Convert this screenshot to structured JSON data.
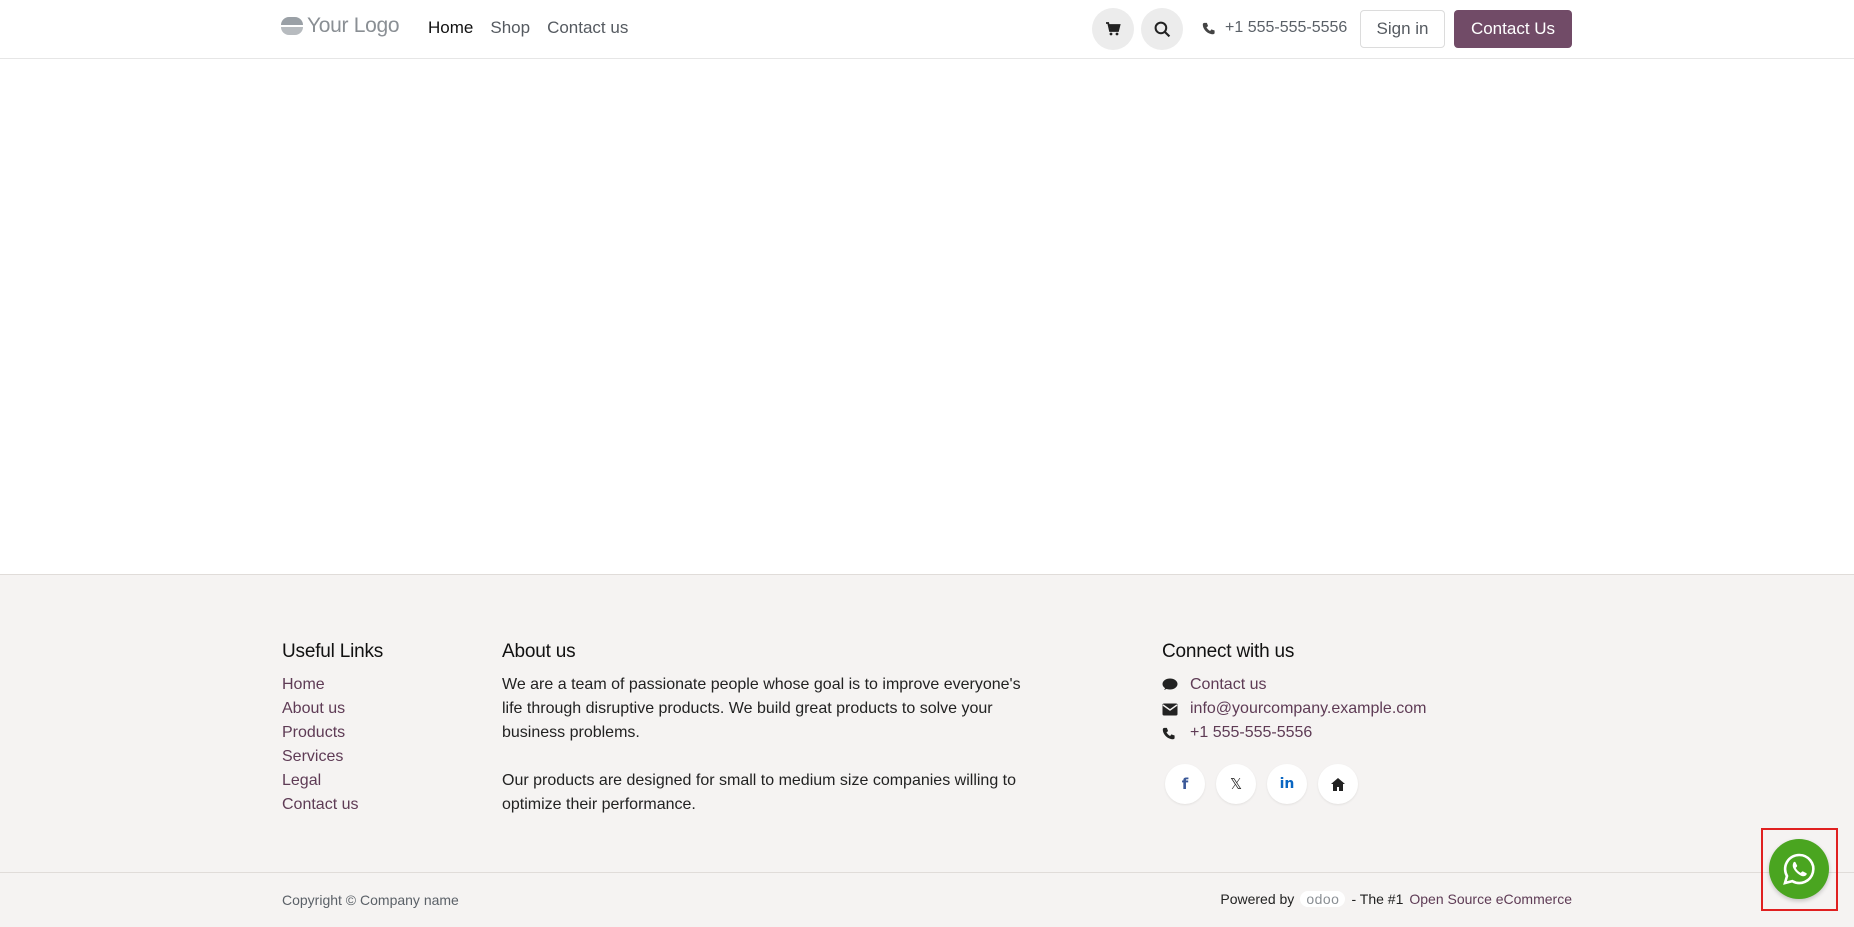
{
  "header": {
    "logo_text": "Your Logo",
    "nav": [
      "Home",
      "Shop",
      "Contact us"
    ],
    "active_nav": "Home",
    "phone": "+1 555-555-5556",
    "sign_in": "Sign in",
    "contact_button": "Contact Us",
    "accent_color": "#714b67"
  },
  "footer": {
    "useful_links": {
      "title": "Useful Links",
      "items": [
        "Home",
        "About us",
        "Products",
        "Services",
        "Legal",
        "Contact us"
      ]
    },
    "about": {
      "title": "About us",
      "paragraphs": [
        "We are a team of passionate people whose goal is to improve everyone's life through disruptive products. We build great products to solve your business problems.",
        "Our products are designed for small to medium size companies willing to optimize their performance."
      ]
    },
    "connect": {
      "title": "Connect with us",
      "items": [
        {
          "icon": "comment-icon",
          "text": "Contact us"
        },
        {
          "icon": "envelope-icon",
          "text": "info@yourcompany.example.com"
        },
        {
          "icon": "phone-icon",
          "text": "+1 555-555-5556"
        }
      ],
      "socials": [
        "facebook-icon",
        "x-icon",
        "linkedin-icon",
        "home-icon"
      ]
    },
    "copyright": "Copyright © Company name",
    "powered_prefix": "Powered by",
    "powered_brand": "odoo",
    "powered_middle": "- The #1",
    "powered_link": "Open Source eCommerce"
  },
  "whatsapp": {
    "icon": "whatsapp-icon",
    "color": "#4aa520"
  }
}
